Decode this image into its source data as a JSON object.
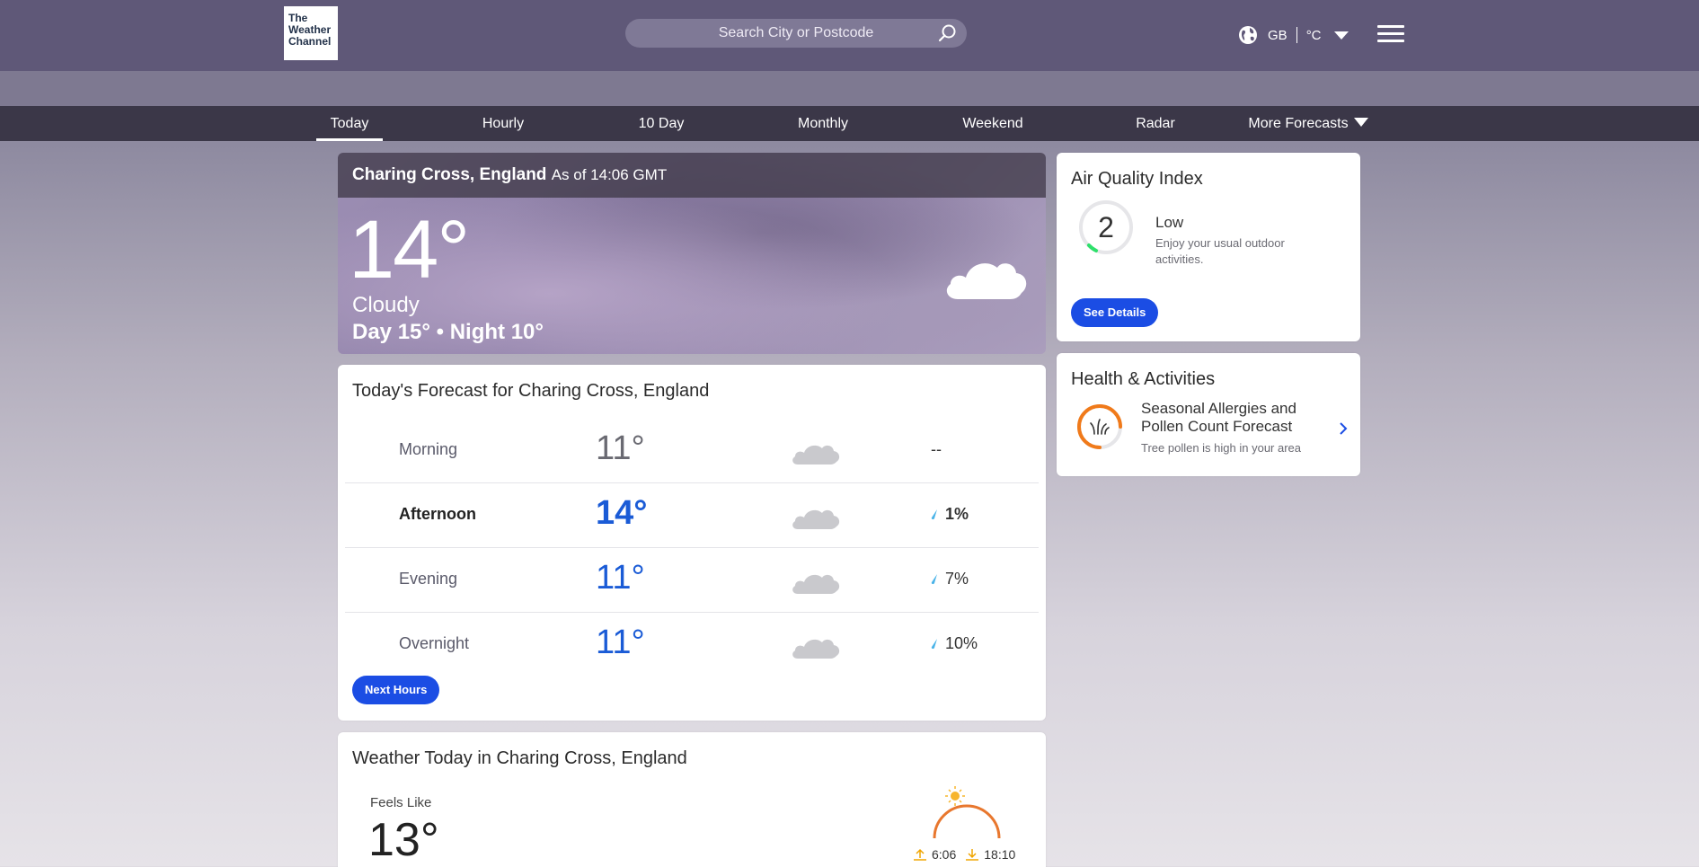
{
  "header": {
    "logo_text": "The Weather Channel",
    "logo_line1": "The",
    "logo_line2": "Weather",
    "logo_line3": "Channel",
    "search_placeholder": "Search City or Postcode",
    "region": "GB",
    "unit": "°C"
  },
  "nav": {
    "items": [
      "Today",
      "Hourly",
      "10 Day",
      "Monthly",
      "Weekend",
      "Radar",
      "More Forecasts"
    ],
    "active": "Today"
  },
  "hero": {
    "location": "Charing Cross, England",
    "as_of": "As of 14:06 GMT",
    "temp": "14°",
    "phrase": "Cloudy",
    "day_night": "Day 15° • Night 10°"
  },
  "forecast": {
    "title": "Today's Forecast for Charing Cross, England",
    "rows": [
      {
        "label": "Morning",
        "temp": "11°",
        "precip": "--"
      },
      {
        "label": "Afternoon",
        "temp": "14°",
        "precip": "1%"
      },
      {
        "label": "Evening",
        "temp": "11°",
        "precip": "7%"
      },
      {
        "label": "Overnight",
        "temp": "11°",
        "precip": "10%"
      }
    ],
    "button": "Next Hours"
  },
  "air_quality": {
    "title": "Air Quality Index",
    "value": "2",
    "category": "Low",
    "description": "Enjoy your usual outdoor activities.",
    "button": "See Details"
  },
  "health": {
    "title": "Health & Activities",
    "item_title": "Seasonal Allergies and Pollen Count Forecast",
    "item_sub": "Tree pollen is high in your area"
  },
  "today": {
    "title": "Weather Today in Charing Cross, England",
    "feels_label": "Feels Like",
    "feels_temp": "13°",
    "sunrise": "6:06",
    "sunset": "18:10"
  },
  "colors": {
    "accent": "#1b4de4",
    "header_bg": "#5f5878",
    "nav_bg": "#3b3748"
  }
}
